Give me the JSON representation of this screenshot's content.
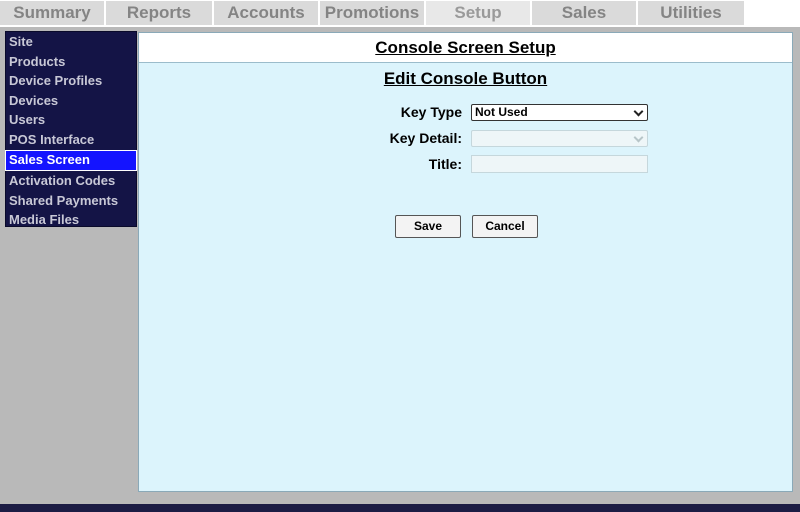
{
  "topnav": {
    "tabs": [
      {
        "label": "Summary"
      },
      {
        "label": "Reports"
      },
      {
        "label": "Accounts"
      },
      {
        "label": "Promotions"
      },
      {
        "label": "Setup"
      },
      {
        "label": "Sales"
      },
      {
        "label": "Utilities"
      }
    ]
  },
  "sidebar": {
    "items": [
      {
        "label": "Site"
      },
      {
        "label": "Products"
      },
      {
        "label": "Device Profiles"
      },
      {
        "label": "Devices"
      },
      {
        "label": "Users"
      },
      {
        "label": "POS Interface"
      },
      {
        "label": "Sales Screen"
      },
      {
        "label": "Activation Codes"
      },
      {
        "label": "Shared Payments"
      },
      {
        "label": "Media Files"
      }
    ]
  },
  "content": {
    "header": "Console Screen Setup",
    "subtitle": "Edit Console Button",
    "form": {
      "key_type_label": "Key Type",
      "key_type_value": "Not Used",
      "key_detail_label": "Key Detail:",
      "key_detail_value": "",
      "title_label": "Title:",
      "title_value": ""
    },
    "buttons": {
      "save": "Save",
      "cancel": "Cancel"
    }
  },
  "colors": {
    "sidebar_bg": "#141446",
    "sidebar_active": "#1414ff",
    "content_bg": "#dcf4fc",
    "frame_bg": "#b9b9b9"
  },
  "icons": [
    "chevron-down-icon"
  ]
}
